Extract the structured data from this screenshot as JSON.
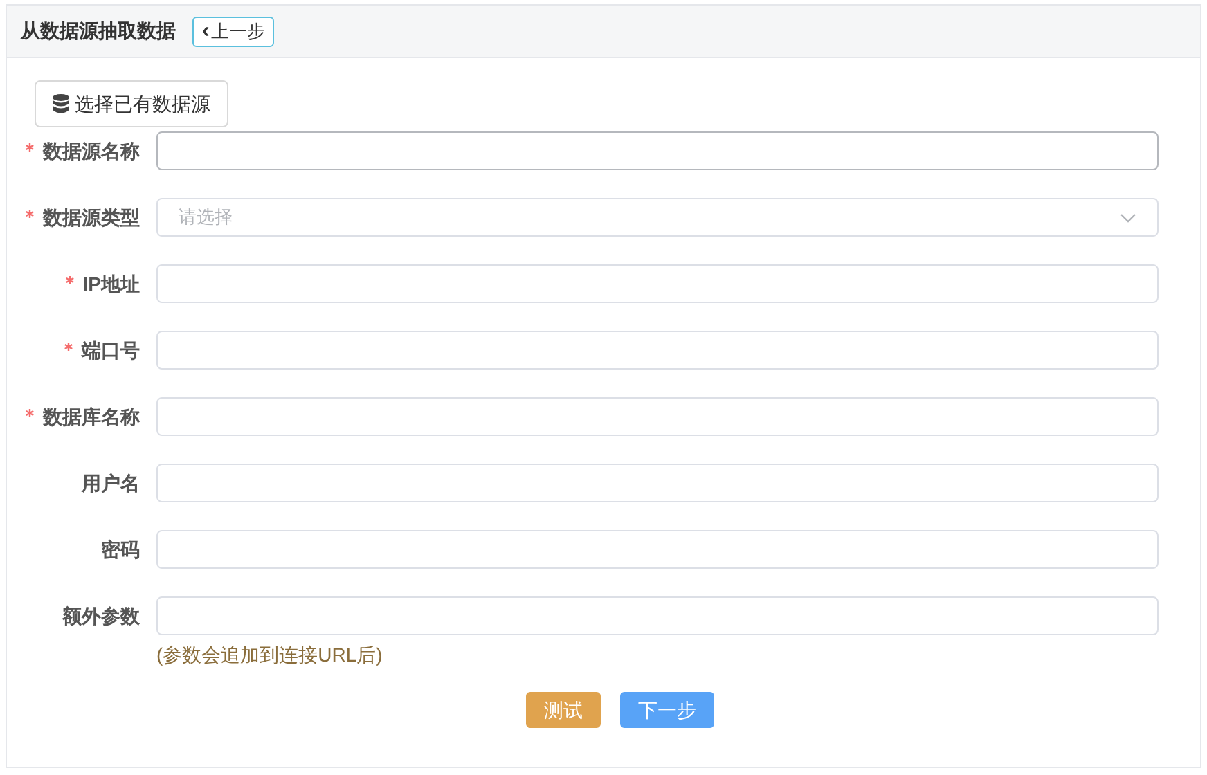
{
  "header": {
    "title": "从数据源抽取数据",
    "back_button": {
      "icon": "‹",
      "label": "上一步"
    }
  },
  "select_existing_button": {
    "label": "选择已有数据源"
  },
  "fields": [
    {
      "kind": "text",
      "label": "数据源名称",
      "required": true,
      "focused": true
    },
    {
      "kind": "select",
      "label": "数据源类型",
      "required": true,
      "focused": false,
      "placeholder": "请选择"
    },
    {
      "kind": "text",
      "label": "IP地址",
      "required": true,
      "focused": false
    },
    {
      "kind": "text",
      "label": "端口号",
      "required": true,
      "focused": false
    },
    {
      "kind": "text",
      "label": "数据库名称",
      "required": true,
      "focused": false
    },
    {
      "kind": "text",
      "label": "用户名",
      "required": false,
      "focused": false
    },
    {
      "kind": "text",
      "label": "密码",
      "required": false,
      "focused": false
    },
    {
      "kind": "text",
      "label": "额外参数",
      "required": false,
      "focused": false,
      "hint": "(参数会追加到连接URL后)"
    }
  ],
  "buttons": [
    {
      "kind": "warning",
      "label": "测试"
    },
    {
      "kind": "primary",
      "label": "下一步"
    }
  ]
}
